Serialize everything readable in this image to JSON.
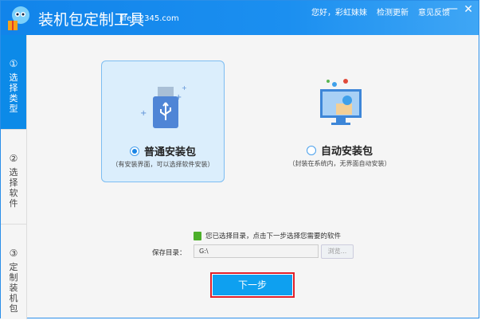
{
  "header": {
    "title": "装机包定制工具",
    "site": "jifen.2345.com",
    "greeting": "您好，彩虹妹妹",
    "check_update": "检测更新",
    "feedback": "意见反馈",
    "minimize": "—",
    "close": "✕"
  },
  "steps": [
    {
      "num": "①",
      "label": "选择类型"
    },
    {
      "num": "②",
      "label": "选择软件"
    },
    {
      "num": "③",
      "label": "定制装机包"
    }
  ],
  "options": [
    {
      "label": "普通安装包",
      "desc": "（有安装界面，可以选择软件安装）",
      "selected": true
    },
    {
      "label": "自动安装包",
      "desc": "（封装在系统内，无界面自动安装）",
      "selected": false
    }
  ],
  "note": "您已选择目录，点击下一步选择您需要的软件",
  "save_dir": {
    "label": "保存目录：",
    "value": "G:\\",
    "browse": "浏览..."
  },
  "next_button": "下一步"
}
